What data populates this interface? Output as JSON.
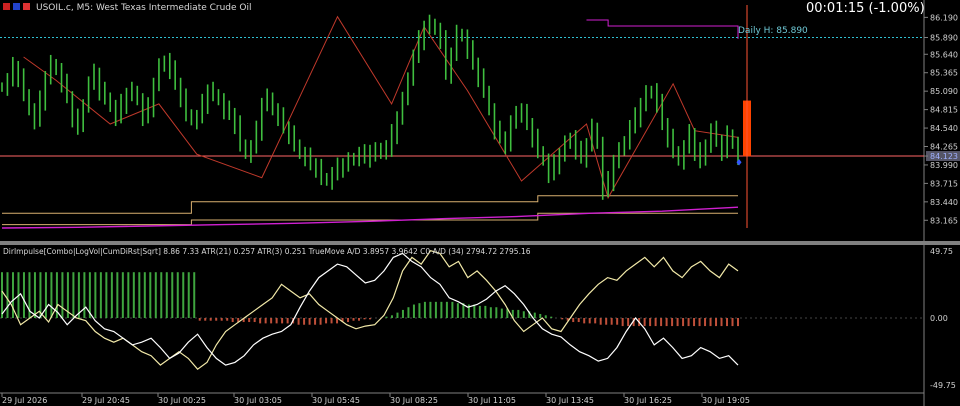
{
  "header": {
    "symbol_line": "USOIL.c, M5:  West Texas Intermediate Crude Oil",
    "countdown": "00:01:15 (-1.00%)",
    "daily_high_label": "Daily H: 85.890"
  },
  "indicator": {
    "label": "DirImpulse[Combo|LogVol|CumDiRst|Sqrt]  8.86  7.33  ATR(21) 0.257  ATR(3) 0.251  TrueMove  A/D  3.8957  3.9642  C0  A/D  (34)  2794.72  2795.16"
  },
  "colors": {
    "background": "#000000",
    "price": "#3fbf3f",
    "zigzag": "#c0392b",
    "daily_high": "#2fbfd0",
    "bid_line": "#ff6666",
    "levels": "#d9b070",
    "ma": "#d020d0",
    "range_bar": "#ff4400",
    "osc_line_a": "#ffffff",
    "osc_line_b": "#f2e9a8",
    "hist_pos": "#3fa53f",
    "hist_neg": "#c0503a",
    "axis_text": "#d0d0d0"
  },
  "chart_data": [
    {
      "type": "line",
      "title": "USOIL.c, M5:  West Texas Intermediate Crude Oil",
      "series_name": "Close",
      "ylim": [
        83.05,
        86.3
      ],
      "price_ticks": [
        "86.190",
        "85.890",
        "85.640",
        "85.365",
        "85.090",
        "84.815",
        "84.540",
        "84.265",
        "84.123",
        "83.990",
        "83.715",
        "83.440",
        "83.165"
      ],
      "x_ticks": [
        "29 Jul 2026",
        "29 Jul 20:45",
        "30 Jul 00:25",
        "30 Jul 03:05",
        "30 Jul 05:45",
        "30 Jul 08:25",
        "30 Jul 11:05",
        "30 Jul 13:45",
        "30 Jul 16:25",
        "30 Jul 19:05"
      ],
      "close": [
        85.15,
        85.25,
        85.45,
        85.3,
        85.05,
        84.8,
        84.65,
        84.95,
        85.3,
        85.5,
        85.4,
        85.2,
        85.0,
        84.7,
        84.55,
        84.9,
        85.2,
        85.35,
        85.1,
        85.0,
        84.85,
        84.7,
        84.9,
        85.05,
        85.1,
        84.95,
        84.7,
        84.85,
        85.2,
        85.45,
        85.55,
        85.4,
        85.2,
        85.0,
        84.75,
        84.65,
        84.7,
        84.9,
        85.1,
        85.05,
        84.95,
        84.8,
        84.75,
        84.6,
        84.3,
        84.15,
        84.25,
        84.5,
        84.9,
        85.0,
        84.8,
        84.7,
        84.55,
        84.45,
        84.3,
        84.15,
        84.1,
        84.0,
        83.95,
        83.8,
        83.75,
        83.85,
        83.95,
        84.0,
        84.05,
        84.1,
        84.15,
        84.1,
        84.2,
        84.15,
        84.25,
        84.2,
        84.45,
        84.7,
        84.95,
        85.3,
        85.6,
        85.85,
        86.05,
        86.1,
        86.0,
        85.85,
        85.35,
        85.65,
        85.95,
        85.9,
        85.7,
        85.5,
        85.3,
        85.1,
        84.8,
        84.5,
        84.4,
        84.3,
        84.6,
        84.8,
        84.75,
        84.6,
        84.4,
        84.2,
        84.05,
        83.85,
        84.0,
        84.15,
        84.3,
        84.4,
        84.2,
        84.1,
        84.3,
        84.55,
        84.3,
        83.6,
        83.75,
        84.05,
        84.2,
        84.35,
        84.55,
        84.7,
        84.9,
        85.05,
        85.1,
        84.9,
        84.6,
        84.4,
        84.2,
        84.05,
        84.25,
        84.45,
        84.2,
        84.05,
        84.3,
        84.5,
        84.35,
        84.2,
        84.45,
        84.3,
        84.12
      ],
      "zigzag": [
        [
          4,
          85.6
        ],
        [
          10,
          85.25
        ],
        [
          20,
          84.6
        ],
        [
          29,
          84.9
        ],
        [
          36,
          84.15
        ],
        [
          48,
          83.8
        ],
        [
          55,
          85.0
        ],
        [
          62,
          86.2
        ],
        [
          72,
          84.9
        ],
        [
          78,
          86.05
        ],
        [
          86,
          85.1
        ],
        [
          96,
          83.75
        ],
        [
          108,
          84.6
        ],
        [
          112,
          83.5
        ],
        [
          124,
          85.2
        ],
        [
          128,
          84.5
        ],
        [
          136,
          84.4
        ]
      ],
      "daily_high": 85.89,
      "bid": 84.123,
      "ma": [
        83.05,
        83.06,
        83.08,
        83.1,
        83.12,
        83.15,
        83.19,
        83.22,
        83.27,
        83.3,
        83.36
      ],
      "levels_upper": [
        [
          0,
          83.27
        ],
        [
          35,
          83.27
        ],
        [
          35,
          83.44
        ],
        [
          99,
          83.44
        ],
        [
          99,
          83.53
        ],
        [
          136,
          83.53
        ]
      ],
      "levels_lower": [
        [
          0,
          83.1
        ],
        [
          35,
          83.1
        ],
        [
          35,
          83.17
        ],
        [
          99,
          83.17
        ],
        [
          99,
          83.27
        ],
        [
          136,
          83.27
        ]
      ],
      "upper_right_level": [
        85.9,
        86.15
      ],
      "range_bar": [
        84.12,
        84.95
      ]
    },
    {
      "type": "line",
      "title": "DirImpulse",
      "ylim": [
        -49.75,
        49.75
      ],
      "y_ticks": [
        "49.75",
        "0.00",
        "-49.75"
      ],
      "hist": [
        34,
        34,
        34,
        34,
        34,
        34,
        34,
        34,
        34,
        34,
        34,
        34,
        34,
        34,
        34,
        34,
        34,
        34,
        34,
        34,
        34,
        34,
        34,
        34,
        34,
        34,
        34,
        34,
        34,
        34,
        34,
        34,
        34,
        34,
        34,
        34,
        -2,
        -2,
        -2,
        -2,
        -2,
        -2,
        -3,
        -3,
        -3,
        -3,
        -3,
        -4,
        -4,
        -4,
        -4,
        -4,
        -4,
        -4,
        -5,
        -5,
        -5,
        -5,
        -5,
        -4,
        -4,
        -4,
        -3,
        -3,
        -2,
        -2,
        -1,
        -1,
        0,
        0,
        1,
        2,
        4,
        6,
        8,
        10,
        11,
        12,
        12,
        12,
        12,
        12,
        12,
        11,
        11,
        10,
        10,
        9,
        9,
        8,
        8,
        7,
        7,
        6,
        6,
        5,
        5,
        4,
        3,
        2,
        1,
        0,
        -1,
        -2,
        -3,
        -3,
        -4,
        -4,
        -4,
        -5,
        -5,
        -5,
        -5,
        -6,
        -6,
        -6,
        -6,
        -6,
        -6,
        -6,
        -6,
        -6,
        -6,
        -6,
        -6,
        -6,
        -6,
        -6,
        -6,
        -6,
        -6,
        -6,
        -6,
        -6,
        -6
      ],
      "line_a": [
        3,
        12,
        18,
        5,
        0,
        10,
        4,
        -5,
        2,
        8,
        -2,
        -8,
        -10,
        -15,
        -20,
        -18,
        -15,
        -22,
        -30,
        -26,
        -18,
        -12,
        -22,
        -30,
        -35,
        -33,
        -28,
        -20,
        -15,
        -12,
        -10,
        -5,
        8,
        20,
        30,
        35,
        40,
        38,
        32,
        26,
        28,
        35,
        45,
        48,
        42,
        38,
        30,
        25,
        15,
        12,
        8,
        10,
        14,
        20,
        24,
        18,
        10,
        0,
        -8,
        -12,
        -14,
        -20,
        -25,
        -28,
        -32,
        -30,
        -22,
        -10,
        0,
        -8,
        -20,
        -15,
        -22,
        -30,
        -28,
        -22,
        -25,
        -30,
        -28,
        -35
      ],
      "line_b": [
        20,
        10,
        -5,
        0,
        5,
        -3,
        10,
        5,
        0,
        -2,
        -10,
        -15,
        -18,
        -15,
        -20,
        -25,
        -28,
        -35,
        -30,
        -25,
        -30,
        -38,
        -33,
        -20,
        -10,
        -5,
        0,
        5,
        10,
        15,
        25,
        20,
        15,
        18,
        10,
        5,
        0,
        -5,
        -8,
        -6,
        -5,
        2,
        15,
        35,
        45,
        40,
        50,
        48,
        38,
        42,
        30,
        35,
        28,
        20,
        10,
        -2,
        -10,
        -5,
        0,
        -8,
        -10,
        0,
        10,
        18,
        25,
        30,
        28,
        35,
        40,
        45,
        38,
        45,
        35,
        30,
        38,
        42,
        35,
        30,
        40,
        35
      ]
    }
  ]
}
